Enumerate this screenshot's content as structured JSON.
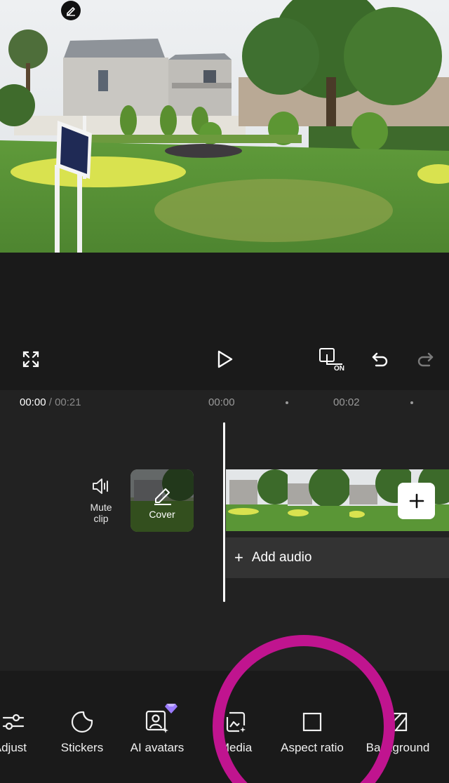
{
  "player": {
    "current_time": "00:00",
    "separator": " / ",
    "total_time": "00:21",
    "sign_text": "ملل پرائیویٹ سکول"
  },
  "ruler": {
    "ticks": [
      "00:00",
      "00:02"
    ]
  },
  "track": {
    "mute_label": "Mute clip",
    "cover_label": "Cover",
    "add_audio_label": "Add audio"
  },
  "toolbar": {
    "items": [
      {
        "label": "Adjust",
        "icon": "sliders-icon"
      },
      {
        "label": "Stickers",
        "icon": "sticker-icon"
      },
      {
        "label": "AI avatars",
        "icon": "avatar-icon"
      },
      {
        "label": "Media",
        "icon": "media-icon"
      },
      {
        "label": "Aspect ratio",
        "icon": "aspect-ratio-icon"
      },
      {
        "label": "Background",
        "icon": "background-icon"
      }
    ]
  },
  "colors": {
    "background": "#1a1a1a",
    "timeline": "#222222",
    "highlight_ring": "#c0148f",
    "premium_badge": "#9b7bff"
  }
}
